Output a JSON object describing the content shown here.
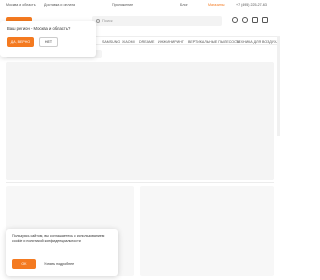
{
  "topbar": {
    "city": "Москва и область",
    "delivery": "Доставка и оплата",
    "app": "Приложение",
    "blog": "Блог",
    "stores": "Магазины",
    "phone": "+7 (495) 225-27-63"
  },
  "header": {
    "search_placeholder": "Поиск",
    "icons": [
      "location-icon",
      "profile-icon",
      "favorites-icon",
      "cart-icon"
    ]
  },
  "categories": [
    "SAMSUNG",
    "XIAOMI",
    "DREAME",
    "ИНЖИНИРИНГ",
    "ВЕРТИКАЛЬНЫЕ ПЫЛЕСОСЫ",
    "ТЕХНИКА ДЛЯ ВОЗДУХА"
  ],
  "region_popup": {
    "question": "Ваш регион - Москва и область?",
    "yes_label": "ДА, ВЕРНО",
    "no_label": "НЕТ"
  },
  "cookie_banner": {
    "text": "Пользуясь сайтом, вы соглашаетесь с использованием cookie и политикой конфиденциальности",
    "ok_label": "OK",
    "more_label": "Узнать подробнее"
  },
  "colors": {
    "accent": "#f47a20",
    "skeleton": "#f4f4f4"
  }
}
